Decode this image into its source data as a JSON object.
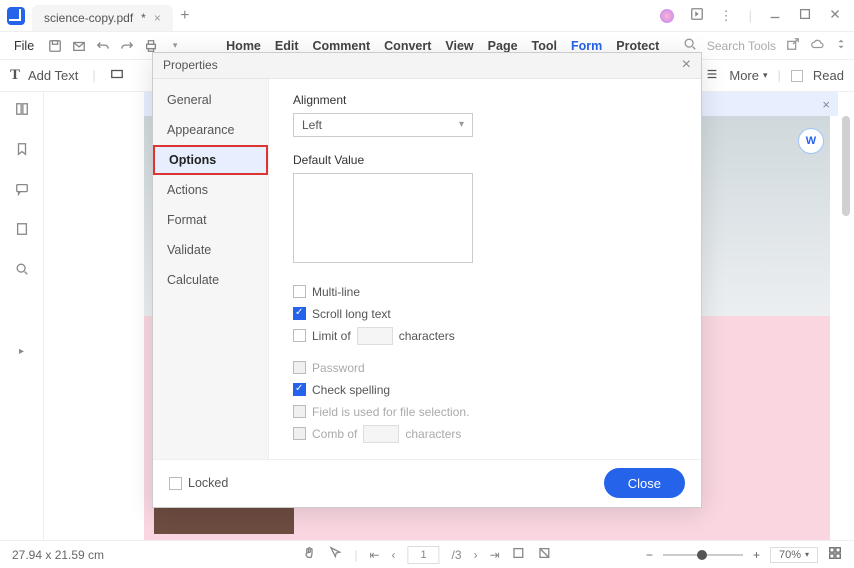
{
  "titlebar": {
    "tab_name": "science-copy.pdf",
    "tab_modified": "*"
  },
  "menubar": {
    "file": "File",
    "items": [
      "Home",
      "Edit",
      "Comment",
      "Convert",
      "View",
      "Page",
      "Tool",
      "Form",
      "Protect"
    ],
    "search_placeholder": "Search Tools"
  },
  "toolbar": {
    "add_text": "Add Text",
    "more": "More",
    "read": "Read"
  },
  "dialog": {
    "title": "Properties",
    "tabs": [
      "General",
      "Appearance",
      "Options",
      "Actions",
      "Format",
      "Validate",
      "Calculate"
    ],
    "alignment_label": "Alignment",
    "alignment_value": "Left",
    "default_value_label": "Default Value",
    "checks": {
      "multiline": "Multi-line",
      "scroll": "Scroll long text",
      "limit_pre": "Limit of",
      "limit_post": "characters",
      "password": "Password",
      "spelling": "Check spelling",
      "fileselect": "Field is used for file selection.",
      "comb_pre": "Comb of",
      "comb_post": "characters"
    },
    "locked": "Locked",
    "close": "Close"
  },
  "status": {
    "dims": "27.94 x 21.59 cm",
    "page_cur": "1",
    "page_total": "/3",
    "zoom": "70%"
  }
}
